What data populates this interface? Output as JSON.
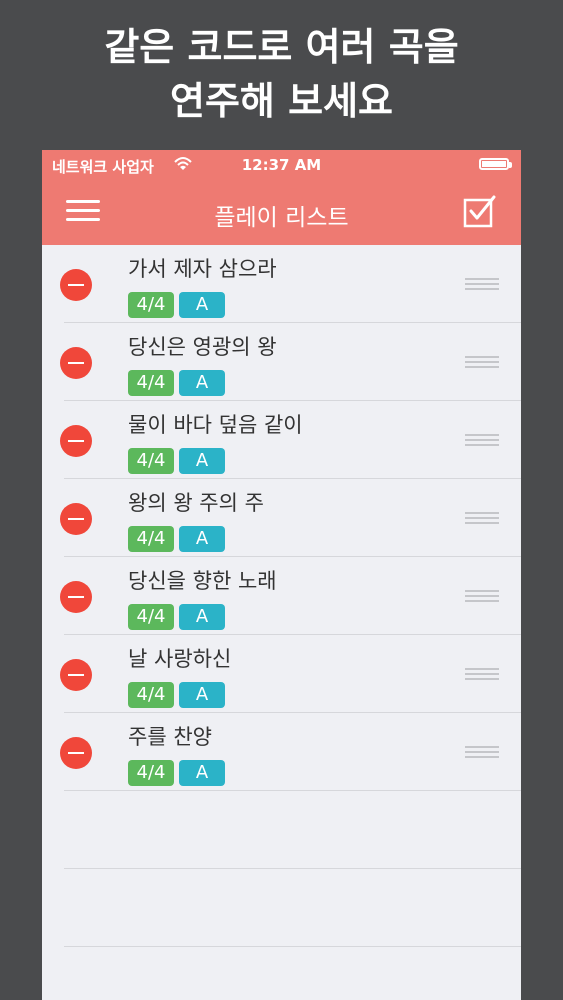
{
  "promo": {
    "line1": "같은 코드로 여러 곡을",
    "line2": "연주해 보세요"
  },
  "status_bar": {
    "carrier": "네트워크 사업자",
    "time": "12:37 AM"
  },
  "nav": {
    "title": "플레이 리스트"
  },
  "colors": {
    "accent": "#ee7a72",
    "delete": "#f0473a",
    "meter_badge": "#5cb85c",
    "key_badge": "#2bb3c8"
  },
  "playlist": [
    {
      "title": "가서 제자 삼으라",
      "meter": "4/4",
      "key": "A"
    },
    {
      "title": "당신은 영광의 왕",
      "meter": "4/4",
      "key": "A"
    },
    {
      "title": "물이 바다 덮음 같이",
      "meter": "4/4",
      "key": "A"
    },
    {
      "title": "왕의 왕 주의 주",
      "meter": "4/4",
      "key": "A"
    },
    {
      "title": "당신을 향한 노래",
      "meter": "4/4",
      "key": "A"
    },
    {
      "title": "날 사랑하신",
      "meter": "4/4",
      "key": "A"
    },
    {
      "title": "주를 찬양",
      "meter": "4/4",
      "key": "A"
    }
  ]
}
